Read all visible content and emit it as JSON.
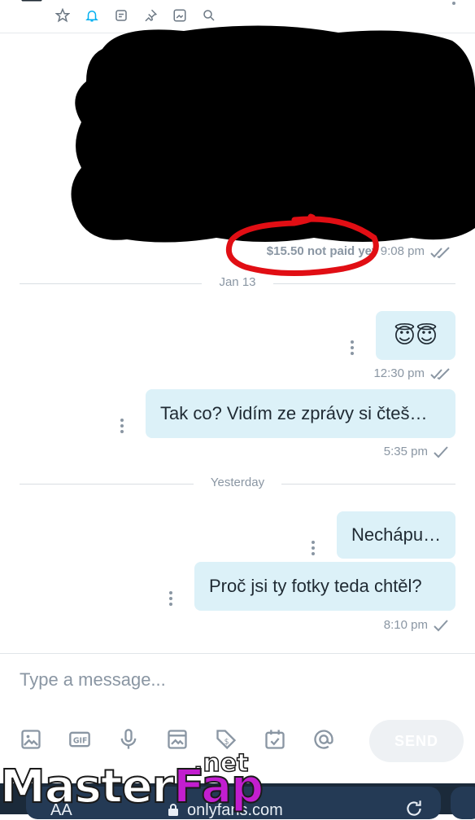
{
  "chat": {
    "price_label": "$15.50 not paid yet",
    "price_time": "9:08 pm",
    "dividers": {
      "jan13": "Jan 13",
      "yesterday": "Yesterday"
    },
    "messages": [
      {
        "text": "😇😇",
        "time": "12:30 pm",
        "status": "read"
      },
      {
        "text": "Tak co? Vidím ze zprávy si čteš…",
        "time": "5:35 pm",
        "status": "sent"
      },
      {
        "text": "Nechápu…",
        "time": "",
        "status": ""
      },
      {
        "text": "Proč jsi ty fotky teda chtěl?",
        "time": "8:10 pm",
        "status": "sent"
      }
    ]
  },
  "composer": {
    "placeholder": "Type a message...",
    "send_label": "SEND",
    "tools": [
      "image-icon",
      "gif-icon",
      "microphone-icon",
      "vault-icon",
      "price-tag-icon",
      "schedule-icon",
      "mention-icon"
    ]
  },
  "browser": {
    "aa_label": "AA",
    "url": "onlyfans.com"
  },
  "watermark": {
    "part1": "Master",
    "part2": "Fap",
    "suffix": ".net"
  },
  "colors": {
    "bubble": "#dcf1f8",
    "accent": "#00aff0",
    "annotation": "#e10e14",
    "muted": "#8a96a3"
  }
}
